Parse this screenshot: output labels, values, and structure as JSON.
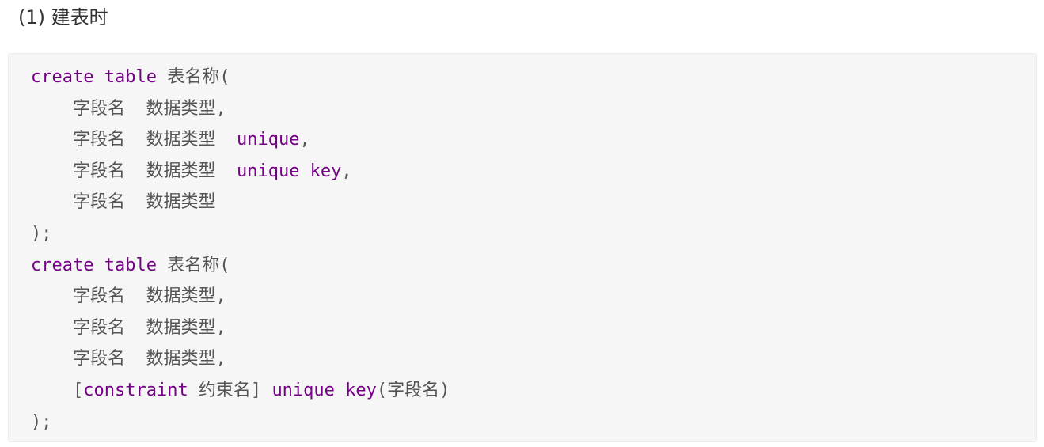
{
  "heading": "(1) 建表时",
  "code": {
    "lines": [
      [
        {
          "text": "create table",
          "kind": "kw"
        },
        {
          "text": " 表名称(",
          "kind": "plain"
        }
      ],
      [
        {
          "text": "    字段名  数据类型,",
          "kind": "plain"
        }
      ],
      [
        {
          "text": "    字段名  数据类型  ",
          "kind": "plain"
        },
        {
          "text": "unique",
          "kind": "kw"
        },
        {
          "text": ",",
          "kind": "plain"
        }
      ],
      [
        {
          "text": "    字段名  数据类型  ",
          "kind": "plain"
        },
        {
          "text": "unique key",
          "kind": "kw"
        },
        {
          "text": ",",
          "kind": "plain"
        }
      ],
      [
        {
          "text": "    字段名  数据类型",
          "kind": "plain"
        }
      ],
      [
        {
          "text": ");",
          "kind": "plain"
        }
      ],
      [
        {
          "text": "create table",
          "kind": "kw"
        },
        {
          "text": " 表名称(",
          "kind": "plain"
        }
      ],
      [
        {
          "text": "    字段名  数据类型,",
          "kind": "plain"
        }
      ],
      [
        {
          "text": "    字段名  数据类型,",
          "kind": "plain"
        }
      ],
      [
        {
          "text": "    字段名  数据类型,",
          "kind": "plain"
        }
      ],
      [
        {
          "text": "    [",
          "kind": "plain"
        },
        {
          "text": "constraint",
          "kind": "kw"
        },
        {
          "text": " 约束名] ",
          "kind": "plain"
        },
        {
          "text": "unique key",
          "kind": "kw"
        },
        {
          "text": "(字段名)",
          "kind": "plain"
        }
      ],
      [
        {
          "text": ");",
          "kind": "plain"
        }
      ]
    ],
    "colors": {
      "keyword": "#770088",
      "plain": "#555555",
      "background": "#f6f6f6"
    }
  }
}
